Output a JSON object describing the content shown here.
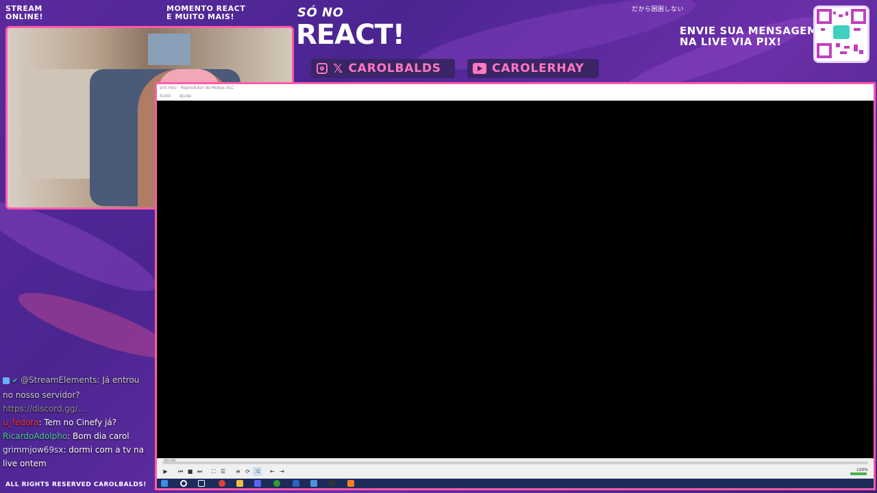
{
  "overlay": {
    "stream_status": "STREAM\nONLINE!",
    "moment_label": "MOMENTO REACT\nE MUITO MAIS!",
    "brand_top": "SÓ NO",
    "brand_main": "REACT!",
    "japanese_text": "だから困困しない",
    "pix_message": "ENVIE SUA MENSAGEM\nNA LIVE VIA PIX!",
    "social_handle_1": "CAROLBALDS",
    "social_handle_2": "CAROLERHAY",
    "footer": "ALL RIGHTS RESERVED CAROLBALDS!"
  },
  "icons": {
    "instagram": "instagram-icon",
    "x": "x-icon",
    "youtube": "youtube-icon"
  },
  "vlc": {
    "title": "arit.mkv - Reprodutor de Mídias VLC",
    "menu": [
      "Exibir",
      "Ajuda"
    ],
    "time_elapsed": "00:00",
    "volume": "100%"
  },
  "chat": [
    {
      "user": "@StreamElements",
      "user_color": "#bfbfbf",
      "message": ": Já entrou no nosso servidor?"
    },
    {
      "user": "",
      "user_color": "#bfbfbf",
      "message": "https://discord.gg/..."
    },
    {
      "user": "u_fedora",
      "user_color": "#ff3030",
      "message": ": Tem no Cinefy já?"
    },
    {
      "user": "RicardoAdolpho",
      "user_color": "#4ecfa0",
      "message": ": Bom dia carol"
    },
    {
      "user": "grimmjow69sx",
      "user_color": "#e0e0ff",
      "message": ": dormi com a tv na live ontem"
    }
  ],
  "colors": {
    "accent": "#ff5ca8",
    "pill_bg": "#3a2566",
    "background": "#5b2a9e"
  }
}
